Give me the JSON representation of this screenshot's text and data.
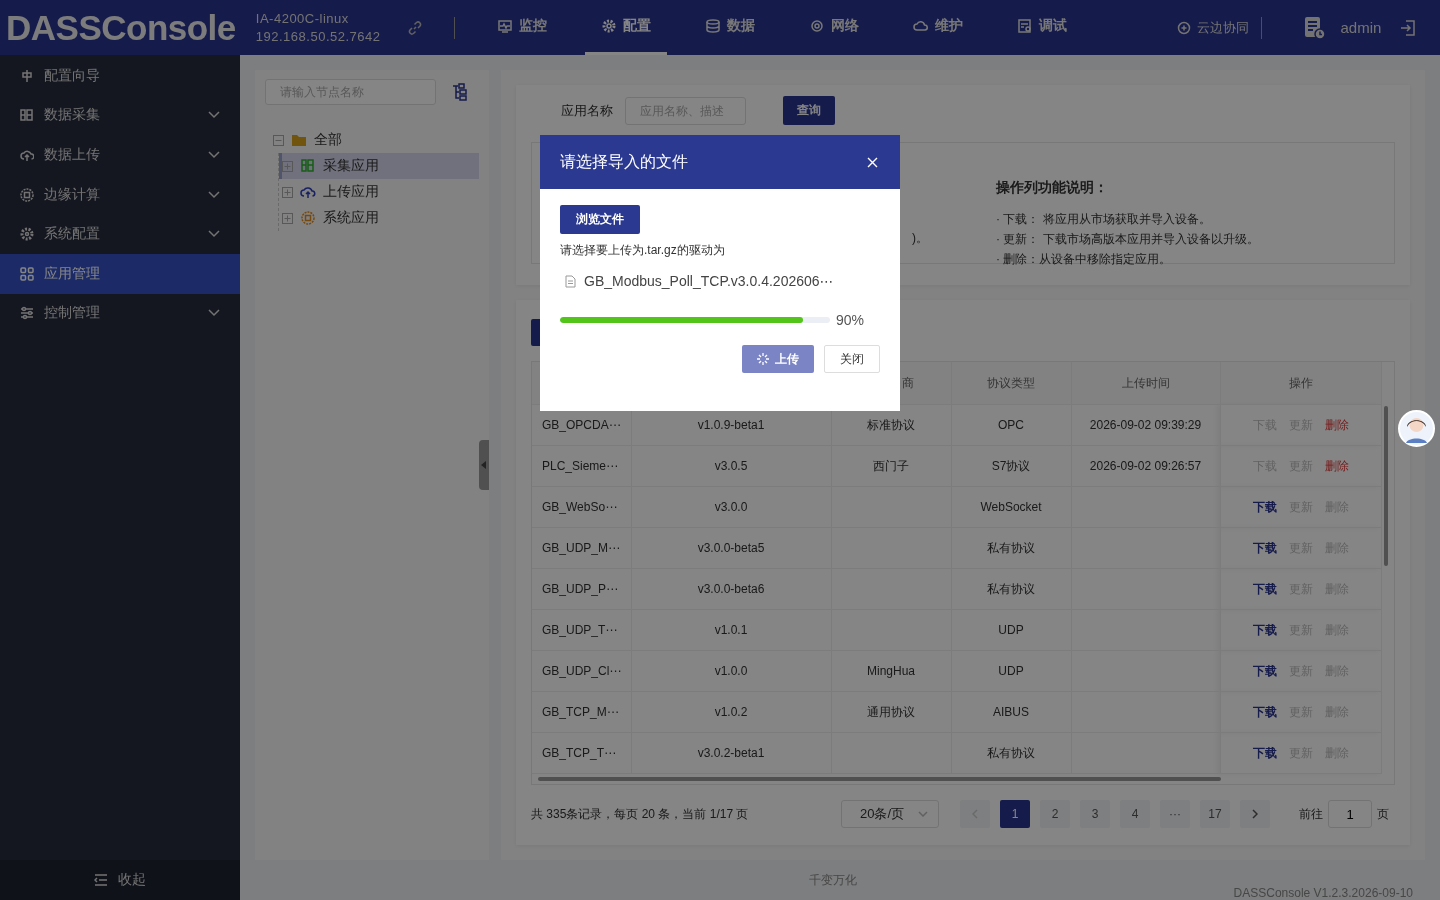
{
  "header": {
    "logo": "DASSConsole",
    "device": "IA-4200C-linux",
    "address": "192.168.50.52.7642",
    "nav": [
      {
        "label": "监控",
        "selected": false
      },
      {
        "label": "配置",
        "selected": true
      },
      {
        "label": "数据",
        "selected": false
      },
      {
        "label": "网络",
        "selected": false
      },
      {
        "label": "维护",
        "selected": false
      },
      {
        "label": "调试",
        "selected": false
      }
    ],
    "cloud": "云边协同",
    "user": "admin"
  },
  "sidebar": {
    "items": [
      {
        "label": "配置向导",
        "expandable": false,
        "selected": false
      },
      {
        "label": "数据采集",
        "expandable": true,
        "selected": false
      },
      {
        "label": "数据上传",
        "expandable": true,
        "selected": false
      },
      {
        "label": "边缘计算",
        "expandable": true,
        "selected": false
      },
      {
        "label": "系统配置",
        "expandable": true,
        "selected": false
      },
      {
        "label": "应用管理",
        "expandable": false,
        "selected": true
      },
      {
        "label": "控制管理",
        "expandable": true,
        "selected": false
      }
    ],
    "collapse": "收起"
  },
  "tree": {
    "search_placeholder": "请输入节点名称",
    "nodes": [
      {
        "label": "全部",
        "expanded": true,
        "selected": false,
        "children": [
          {
            "label": "采集应用",
            "expanded": false,
            "selected": true
          },
          {
            "label": "上传应用",
            "expanded": false,
            "selected": false
          },
          {
            "label": "系统应用",
            "expanded": false,
            "selected": false
          }
        ]
      }
    ]
  },
  "filter": {
    "label": "应用名称",
    "placeholder": "应用名称、描述",
    "button": "查询"
  },
  "notes": {
    "fragment": ")。",
    "title": "操作列功能说明：",
    "items": [
      "· 下载： 将应用从市场获取并导入设备。",
      "· 更新： 下载市场高版本应用并导入设备以升级。",
      "· 删除：从设备中移除指定应用。"
    ]
  },
  "table": {
    "columns": [
      "",
      "",
      "商",
      "协议类型",
      "上传时间",
      "操作"
    ],
    "rows": [
      {
        "cells": [
          "GB_OPCDA⋯",
          "v1.0.9-beta1",
          "标准协议",
          "OPC",
          "2026-09-02 09:39:29"
        ],
        "actions": [
          {
            "kind": "download",
            "label": "下载",
            "disabled": true
          },
          {
            "kind": "update",
            "label": "更新",
            "disabled": true
          },
          {
            "kind": "delete",
            "label": "删除",
            "disabled": false
          }
        ]
      },
      {
        "cells": [
          "PLC_Sieme⋯",
          "v3.0.5",
          "西门子",
          "S7协议",
          "2026-09-02 09:26:57"
        ],
        "actions": [
          {
            "kind": "download",
            "label": "下载",
            "disabled": true
          },
          {
            "kind": "update",
            "label": "更新",
            "disabled": true
          },
          {
            "kind": "delete",
            "label": "删除",
            "disabled": false
          }
        ]
      },
      {
        "cells": [
          "GB_WebSo⋯",
          "v3.0.0",
          "",
          "WebSocket",
          ""
        ],
        "actions": [
          {
            "kind": "download",
            "label": "下载",
            "disabled": false
          },
          {
            "kind": "update",
            "label": "更新",
            "disabled": true
          },
          {
            "kind": "delete",
            "label": "删除",
            "disabled": true
          }
        ]
      },
      {
        "cells": [
          "GB_UDP_M⋯",
          "v3.0.0-beta5",
          "",
          "私有协议",
          ""
        ],
        "actions": [
          {
            "kind": "download",
            "label": "下载",
            "disabled": false
          },
          {
            "kind": "update",
            "label": "更新",
            "disabled": true
          },
          {
            "kind": "delete",
            "label": "删除",
            "disabled": true
          }
        ]
      },
      {
        "cells": [
          "GB_UDP_P⋯",
          "v3.0.0-beta6",
          "",
          "私有协议",
          ""
        ],
        "actions": [
          {
            "kind": "download",
            "label": "下载",
            "disabled": false
          },
          {
            "kind": "update",
            "label": "更新",
            "disabled": true
          },
          {
            "kind": "delete",
            "label": "删除",
            "disabled": true
          }
        ]
      },
      {
        "cells": [
          "GB_UDP_T⋯",
          "v1.0.1",
          "",
          "UDP",
          ""
        ],
        "actions": [
          {
            "kind": "download",
            "label": "下载",
            "disabled": false
          },
          {
            "kind": "update",
            "label": "更新",
            "disabled": true
          },
          {
            "kind": "delete",
            "label": "删除",
            "disabled": true
          }
        ]
      },
      {
        "cells": [
          "GB_UDP_Cl⋯",
          "v1.0.0",
          "MingHua",
          "UDP",
          ""
        ],
        "actions": [
          {
            "kind": "download",
            "label": "下载",
            "disabled": false
          },
          {
            "kind": "update",
            "label": "更新",
            "disabled": true
          },
          {
            "kind": "delete",
            "label": "删除",
            "disabled": true
          }
        ]
      },
      {
        "cells": [
          "GB_TCP_M⋯",
          "v1.0.2",
          "通用协议",
          "AIBUS",
          ""
        ],
        "actions": [
          {
            "kind": "download",
            "label": "下载",
            "disabled": false
          },
          {
            "kind": "update",
            "label": "更新",
            "disabled": true
          },
          {
            "kind": "delete",
            "label": "删除",
            "disabled": true
          }
        ]
      },
      {
        "cells": [
          "GB_TCP_T⋯",
          "v3.0.2-beta1",
          "",
          "私有协议",
          ""
        ],
        "actions": [
          {
            "kind": "download",
            "label": "下载",
            "disabled": false
          },
          {
            "kind": "update",
            "label": "更新",
            "disabled": true
          },
          {
            "kind": "delete",
            "label": "删除",
            "disabled": true
          }
        ]
      }
    ]
  },
  "pagination": {
    "summary": "共 335条记录，每页 20 条，当前 1/17 页",
    "page_size": "20条/页",
    "pages": [
      {
        "label": "1",
        "selected": true
      },
      {
        "label": "2",
        "selected": false
      },
      {
        "label": "3",
        "selected": false
      },
      {
        "label": "4",
        "selected": false
      },
      {
        "label": "···",
        "selected": false
      },
      {
        "label": "17",
        "selected": false
      }
    ],
    "goto_label": "前往",
    "goto_value": "1",
    "goto_suffix": "页"
  },
  "footer": {
    "slogan": "千变万化",
    "version": "DASSConsole V1.2.3.2026-09-10"
  },
  "dialog": {
    "title": "请选择导入的文件",
    "browse": "浏览文件",
    "hint": "请选择要上传为.tar.gz的驱动为",
    "file": "GB_Modbus_Poll_TCP.v3.0.4.202606⋯",
    "progress": {
      "level": 0.9,
      "reading": "90%"
    },
    "buttons": [
      {
        "kind": "primary",
        "label": "上传",
        "loading": true
      },
      {
        "kind": "default",
        "label": "关闭",
        "loading": false
      }
    ]
  }
}
